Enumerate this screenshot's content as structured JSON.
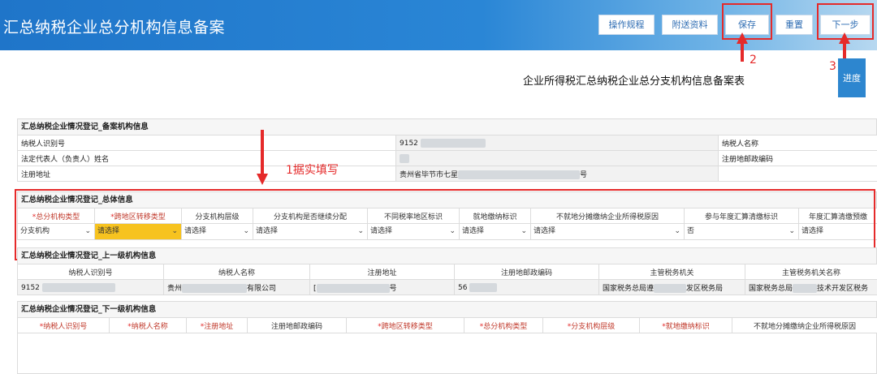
{
  "header": {
    "title": "汇总纳税企业总分机构信息备案",
    "buttons": {
      "rules": "操作规程",
      "attach": "附送资料",
      "save": "保存",
      "reset": "重置",
      "next": "下一步"
    },
    "progress": "进度"
  },
  "annotations": {
    "a1": "1据实填写",
    "a2": "2",
    "a3": "3"
  },
  "form_title": "企业所得税汇总纳税企业总分支机构信息备案表",
  "section_filing": {
    "title": "汇总纳税企业情况登记_备案机构信息",
    "taxpayer_id_label": "纳税人识别号",
    "taxpayer_id_value": "9152",
    "taxpayer_name_label": "纳税人名称",
    "legal_rep_label": "法定代表人（负责人）姓名",
    "postal_label": "注册地邮政编码",
    "address_label": "注册地址",
    "address_value_a": "贵州省毕节市七星",
    "address_value_b": "号"
  },
  "section_overall": {
    "title": "汇总纳税企业情况登记_总体信息",
    "headers": [
      "总分机构类型",
      "跨地区转移类型",
      "分支机构层级",
      "分支机构是否继续分配",
      "不同税率地区标识",
      "就地缴纳标识",
      "不就地分摊缴纳企业所得税原因",
      "参与年度汇算清缴标识",
      "年度汇算清缴预缴"
    ],
    "values": [
      "分支机构",
      "请选择",
      "请选择",
      "请选择",
      "请选择",
      "请选择",
      "请选择",
      "否",
      "请选择"
    ]
  },
  "section_upper": {
    "title": "汇总纳税企业情况登记_上一级机构信息",
    "headers": [
      "纳税人识别号",
      "纳税人名称",
      "注册地址",
      "注册地邮政编码",
      "主管税务机关",
      "主管税务机关名称"
    ],
    "values": {
      "id": "9152",
      "name_a": "贵州",
      "name_b": "有限公司",
      "addr_a": "[",
      "addr_b": "号",
      "postal": "56",
      "auth_a": "国家税务总局遵",
      "auth_b": "发区税务局",
      "auth_name_a": "国家税务总局",
      "auth_name_b": "技术开发区税务"
    }
  },
  "section_lower": {
    "title": "汇总纳税企业情况登记_下一级机构信息",
    "headers": [
      "纳税人识别号",
      "纳税人名称",
      "注册地址",
      "注册地邮政编码",
      "跨地区转移类型",
      "总分机构类型",
      "分支机构层级",
      "就地缴纳标识",
      "不就地分摊缴纳企业所得税原因"
    ]
  }
}
